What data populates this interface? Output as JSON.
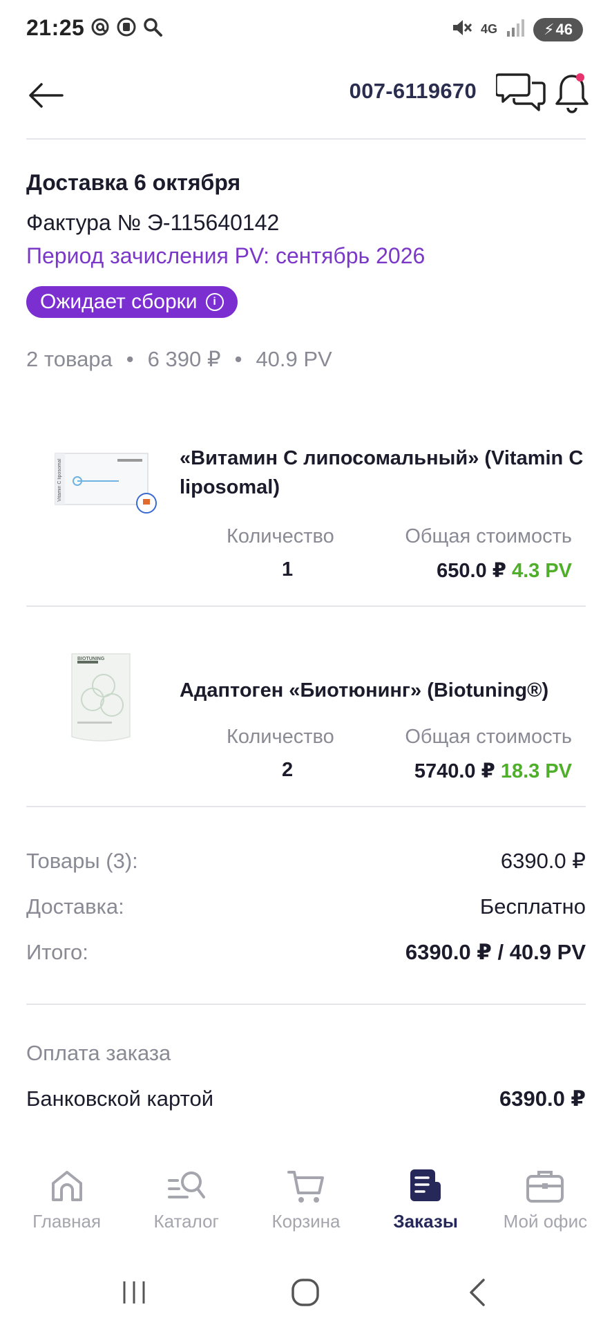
{
  "status_bar": {
    "time": "21:25",
    "network": "4G",
    "battery": "46"
  },
  "header": {
    "order_number": "007-6119670"
  },
  "delivery": {
    "title": "Доставка 6 октября",
    "invoice": "Фактура № Э-115640142",
    "pv_period": "Период зачисления PV: сентябрь 2026",
    "status_badge": "Ожидает сборки"
  },
  "summary_line": {
    "items_count": "2 товара",
    "sum": "6 390 ₽",
    "pv": "40.9 PV",
    "separator": "•"
  },
  "items": [
    {
      "name": "«Витамин С липосомальный» (Vitamin C liposomal)",
      "qty_label": "Количество",
      "qty": "1",
      "cost_label": "Общая стоимость",
      "price": "650.0 ₽",
      "pv": "4.3 PV",
      "image_label": "Vitamin C liposomal"
    },
    {
      "name": "Адаптоген «Биотюнинг» (Biotuning®)",
      "qty_label": "Количество",
      "qty": "2",
      "cost_label": "Общая стоимость",
      "price": "5740.0 ₽",
      "pv": "18.3 PV",
      "image_label": "BIOTUNING"
    }
  ],
  "totals": {
    "goods_label": "Товары (3):",
    "goods_value": "6390.0 ₽",
    "delivery_label": "Доставка:",
    "delivery_value": "Бесплатно",
    "total_label": "Итого:",
    "total_value": "6390.0 ₽ / 40.9 PV"
  },
  "payment": {
    "title": "Оплата заказа",
    "method": "Банковской картой",
    "amount": "6390.0 ₽"
  },
  "bottom_nav": [
    {
      "label": "Главная",
      "icon": "home-icon"
    },
    {
      "label": "Каталог",
      "icon": "catalog-search-icon"
    },
    {
      "label": "Корзина",
      "icon": "cart-icon"
    },
    {
      "label": "Заказы",
      "icon": "orders-icon"
    },
    {
      "label": "Мой офис",
      "icon": "briefcase-icon"
    }
  ],
  "colors": {
    "accent_purple": "#7b2fd0",
    "pv_green": "#4fae2a",
    "nav_active": "#26285a",
    "muted": "#8a8a95"
  }
}
